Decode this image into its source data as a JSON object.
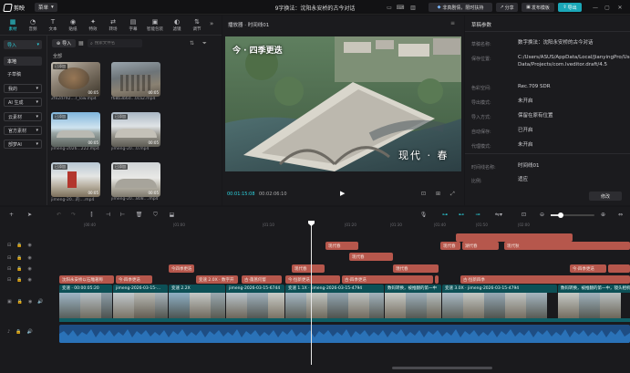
{
  "app": {
    "logo_text": "剪映",
    "menu_label": "菜单",
    "window_title": "9字换法：沈阳永安桥的古今对话",
    "promo_label": "非真剧情，限时扶持",
    "share_label": "分享",
    "publish_label": "发布模板",
    "export_label": "导出",
    "pro_badge": "VIP"
  },
  "tools": [
    {
      "label": "素材",
      "icon": "▦"
    },
    {
      "label": "音频",
      "icon": "◔"
    },
    {
      "label": "文本",
      "icon": "T"
    },
    {
      "label": "贴纸",
      "icon": "◉"
    },
    {
      "label": "特效",
      "icon": "✦"
    },
    {
      "label": "转场",
      "icon": "⇄"
    },
    {
      "label": "字幕",
      "icon": "▤"
    },
    {
      "label": "智能包装",
      "icon": "▣"
    },
    {
      "label": "滤镜",
      "icon": "◐"
    },
    {
      "label": "调节",
      "icon": "⇅"
    }
  ],
  "tools_more": "»",
  "sidebar": {
    "import": "导入",
    "items": [
      "本地",
      "子草稿",
      "我的",
      "AI 生成",
      "云素材",
      "官方素材",
      "部梦AI"
    ]
  },
  "media": {
    "import_btn": "导入",
    "search_placeholder": "搜索文件名",
    "filter_all": "全部",
    "items": [
      {
        "badge": "已添加",
        "duration": "00:05",
        "name": "2fe2d792...7_low.mp4"
      },
      {
        "badge": "",
        "duration": "00:05",
        "name": "f68b3b6d...0ca2.mp4"
      },
      {
        "badge": "已添加",
        "duration": "00:05",
        "name": "jimeng-2026...222.mp4"
      },
      {
        "badge": "已添加",
        "duration": "00:05",
        "name": "jimeng-20...0.mp4"
      },
      {
        "badge": "已添加",
        "duration": "00:05",
        "name": "jimeng-20...的....mp4"
      },
      {
        "badge": "已添加",
        "duration": "00:05",
        "name": "jimeng-20...808....mp4"
      }
    ]
  },
  "player": {
    "title": "播放器 · 时间线01",
    "video_overlay_text": "今 · 四季更迭",
    "video_caption": "现代 · 春",
    "current_time": "00:01:15:08",
    "total_time": "00:02:06:10",
    "play_icon": "▶"
  },
  "properties": {
    "panel_title": "草稿参数",
    "rows": [
      {
        "k": "草稿名称:",
        "v": "数字换法：沈阳永安桥的古今对话"
      },
      {
        "k": "保存位置:",
        "v": "C:/Users/ASUS/AppData/Local/JianyingPro/User Data/Projects/com.lveditor.draft/4.5"
      },
      {
        "k": "色彩空间:",
        "v": "Rec.709 SDR"
      },
      {
        "k": "导出模式:",
        "v": "未开启"
      },
      {
        "k": "导入方式:",
        "v": "保留在原有位置"
      },
      {
        "k": "自动保存:",
        "v": "已开启"
      },
      {
        "k": "代理模式:",
        "v": "未开启"
      },
      {
        "k": "时间线名称:",
        "v": "时间线01"
      },
      {
        "k": "比例:",
        "v": "适应"
      }
    ],
    "edit_button": "修改"
  },
  "timeline": {
    "ticks": [
      "|00:40",
      "|01:00",
      "|01:10",
      "|01:20",
      "|01:30",
      "|01:40",
      "|01:50",
      "|02:00"
    ],
    "text_clips": [
      {
        "label": "现代春",
        "color": "red"
      },
      {
        "label": "现代春",
        "color": "red"
      },
      {
        "label": "湖代春",
        "color": "red"
      },
      {
        "label": "现代秋",
        "color": "red"
      },
      {
        "label": "今四季更迭",
        "color": "red"
      },
      {
        "label": "现代春",
        "color": "red"
      },
      {
        "label": "现代春",
        "color": "red"
      },
      {
        "label": "現代春",
        "color": "red"
      },
      {
        "label": "今·四季更迭",
        "color": "red"
      },
      {
        "label": "古·四季更迭",
        "color": "red"
      },
      {
        "label": "今·四季更迭",
        "color": "red"
      },
      {
        "label": "古·蓬蒿何瞀",
        "color": "red"
      },
      {
        "label": "沈阳永安桥以石雕著称",
        "color": "red"
      },
      {
        "label": "变速 2.0X · 数字开",
        "color": "red"
      },
      {
        "label": "今·恒新更迭",
        "color": "red"
      },
      {
        "label": "古·恒新四季",
        "color": "red"
      }
    ],
    "video_clips": [
      "变速 · 00:00:05:20",
      "jimeng-2026-03-15-...",
      "变速 2.2X",
      "jimeng-2026-03-15-6744",
      "变速 1.1X · jimeng-2026-03-15-4794",
      "数码转换，被推翻的第一中",
      "变速 3.0X · jimeng-2026-03-15-4794",
      "数码转换，被推翻的第一中，镜头相机"
    ]
  }
}
